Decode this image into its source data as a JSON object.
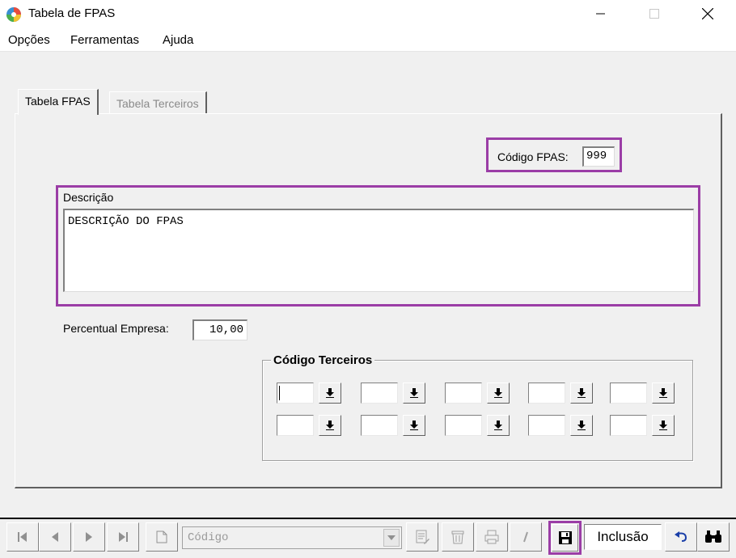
{
  "window": {
    "title": "Tabela de FPAS"
  },
  "menu": {
    "items": [
      "Opções",
      "Ferramentas",
      "Ajuda"
    ]
  },
  "tabs": [
    {
      "label": "Tabela FPAS",
      "active": true
    },
    {
      "label": "Tabela Terceiros",
      "active": false
    }
  ],
  "form": {
    "codigo_label": "Código FPAS:",
    "codigo_value": "999",
    "descricao_label": "Descrição",
    "descricao_value": "DESCRIÇÃO DO FPAS",
    "percentual_label": "Percentual Empresa:",
    "percentual_value": "10,00",
    "terceiros_label": "Código Terceiros",
    "terceiros_values": [
      "",
      "",
      "",
      "",
      "",
      "",
      "",
      "",
      "",
      ""
    ]
  },
  "toolbar": {
    "search_placeholder": "Código",
    "mode_status": "Inclusão",
    "icons": [
      "first-record-icon",
      "previous-record-icon",
      "next-record-icon",
      "last-record-icon",
      "new-document-icon",
      "search-dropdown-icon",
      "edit-document-icon",
      "delete-icon",
      "print-icon",
      "italic-icon",
      "save-icon",
      "undo-icon",
      "binoculars-icon"
    ]
  },
  "colors": {
    "highlight": "#9b3da6",
    "window_bg": "#f0f0f0"
  }
}
